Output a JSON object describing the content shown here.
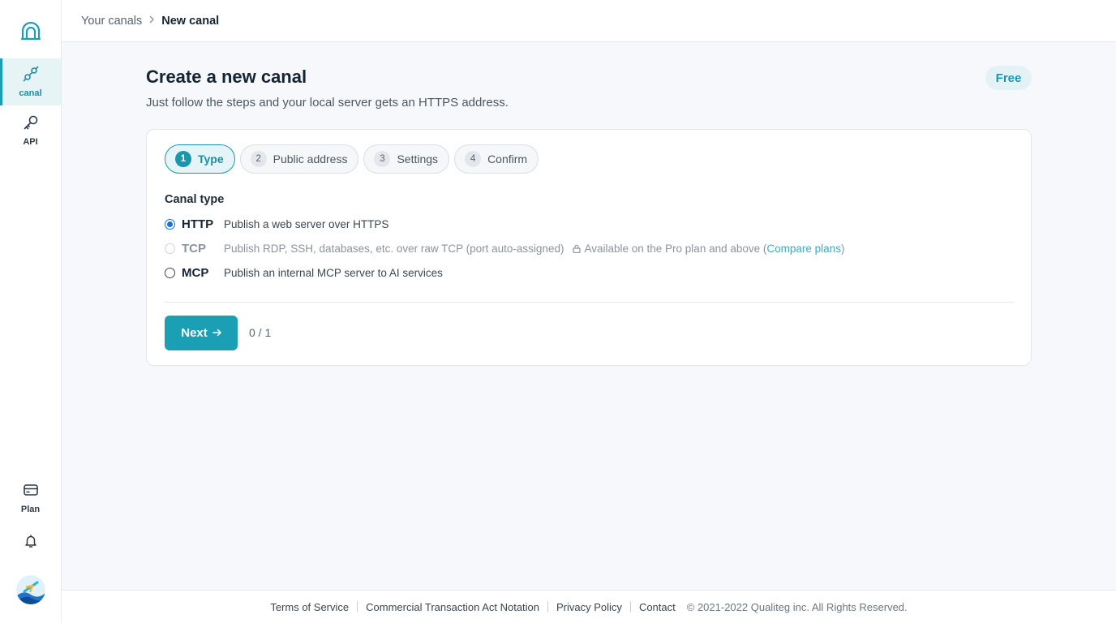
{
  "sidebar": {
    "logo_icon": "tunnel-logo-icon",
    "items": [
      {
        "id": "canal",
        "label": "canal",
        "icon": "link-icon",
        "active": true
      },
      {
        "id": "api",
        "label": "API",
        "icon": "key-icon",
        "active": false
      },
      {
        "id": "plan",
        "label": "Plan",
        "icon": "card-icon",
        "active": false
      }
    ],
    "bell_icon": "bell-icon",
    "avatar_icon": "avatar"
  },
  "breadcrumb": {
    "parent": "Your canals",
    "separator": ">",
    "current": "New canal"
  },
  "page": {
    "title": "Create a new canal",
    "subtitle": "Just follow the steps and your local server gets an HTTPS address.",
    "plan_badge": "Free"
  },
  "steps": [
    {
      "num": "1",
      "label": "Type",
      "active": true
    },
    {
      "num": "2",
      "label": "Public address",
      "active": false
    },
    {
      "num": "3",
      "label": "Settings",
      "active": false
    },
    {
      "num": "4",
      "label": "Confirm",
      "active": false
    }
  ],
  "form": {
    "section_label": "Canal type",
    "options": [
      {
        "name": "HTTP",
        "desc": "Publish a web server over HTTPS",
        "checked": true,
        "disabled": false
      },
      {
        "name": "TCP",
        "desc": "Publish RDP, SSH, databases, etc. over raw TCP (port auto-assigned)",
        "checked": false,
        "disabled": true,
        "availability_prefix": "Available on the Pro plan and above (",
        "compare_link": "Compare plans",
        "availability_suffix": ")"
      },
      {
        "name": "MCP",
        "desc": "Publish an internal MCP server to AI services",
        "checked": false,
        "disabled": false
      }
    ],
    "next_label": "Next",
    "next_arrow": "→",
    "progress": "0 / 1"
  },
  "footer": {
    "links": [
      "Terms of Service",
      "Commercial Transaction Act Notation",
      "Privacy Policy",
      "Contact"
    ],
    "copyright": "© 2021-2022 Qualiteg inc. All Rights Reserved."
  },
  "colors": {
    "accent": "#1b9fb5",
    "radio_checked": "#1a6fe6",
    "badge_bg": "#e3f3f5"
  }
}
